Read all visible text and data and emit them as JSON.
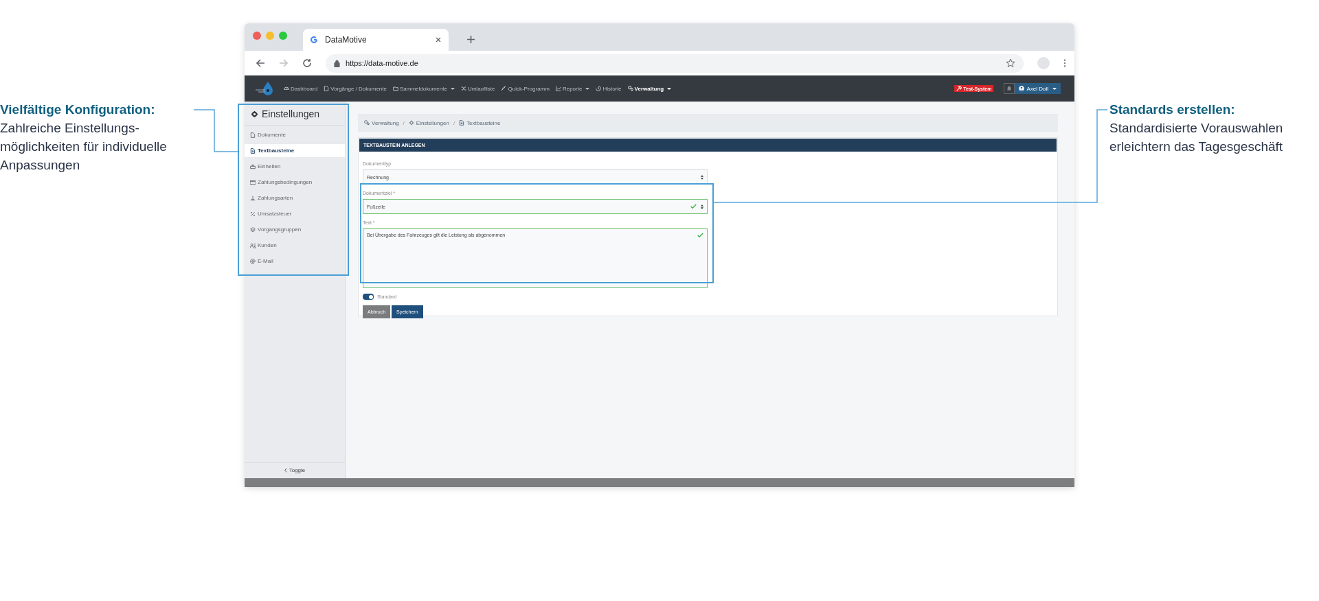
{
  "annotations": [
    {
      "title": "Vielfältige Konfiguration:",
      "lines": [
        "Zahlreiche Einstellungs-",
        "möglichkeiten für individuelle",
        "Anpassungen"
      ]
    },
    {
      "title": "Standards erstellen:",
      "lines": [
        "Standardisierte Vorauswahlen",
        "erleichtern das Tagesgeschäft"
      ]
    }
  ],
  "browser": {
    "tab_title": "DataMotive",
    "url": "https://data-motive.de"
  },
  "navbar": {
    "items": [
      {
        "label": "Dashboard",
        "dropdown": false,
        "active": false
      },
      {
        "label": "Vorgänge / Dokumente",
        "dropdown": false,
        "active": false
      },
      {
        "label": "Sammeldokumente",
        "dropdown": true,
        "active": false
      },
      {
        "label": "Umlaufliste",
        "dropdown": false,
        "active": false
      },
      {
        "label": "Quick-Programm",
        "dropdown": false,
        "active": false
      },
      {
        "label": "Reporte",
        "dropdown": true,
        "active": false
      },
      {
        "label": "Historie",
        "dropdown": false,
        "active": false
      },
      {
        "label": "Verwaltung",
        "dropdown": true,
        "active": true
      }
    ],
    "badge": "Test-System",
    "user": "Axel Doll"
  },
  "sidebar": {
    "title": "Einstellungen",
    "items": [
      {
        "label": "Dokumente",
        "selected": false
      },
      {
        "label": "Textbausteine",
        "selected": true
      },
      {
        "label": "Einheiten",
        "selected": false
      },
      {
        "label": "Zahlungsbedingungen",
        "selected": false
      },
      {
        "label": "Zahlungsarten",
        "selected": false
      },
      {
        "label": "Umsatzsteuer",
        "selected": false
      },
      {
        "label": "Vorgangsgruppen",
        "selected": false
      },
      {
        "label": "Kunden",
        "selected": false
      },
      {
        "label": "E-Mail",
        "selected": false
      }
    ],
    "toggle": "Toggle"
  },
  "breadcrumb": {
    "separator": "/",
    "items": [
      "Verwaltung",
      "Einstellungen",
      "Textbausteine"
    ]
  },
  "form": {
    "header": "TEXTBAUSTEIN ANLEGEN",
    "fields": [
      {
        "kind": "select",
        "label": "Dokumenttyp",
        "value": "Rechnung",
        "valid": false
      },
      {
        "kind": "select",
        "label": "Dokumentziel *",
        "value": "Fußzeile",
        "valid": true
      },
      {
        "kind": "textarea",
        "label": "Text *",
        "value": "Bei Übergabe des Fahrzeuges gilt die Leistung als abgenommen",
        "valid": true
      }
    ],
    "switch": {
      "label": "Standard",
      "on": true
    },
    "buttons": [
      {
        "label": "Abbruch",
        "kind": "secondary"
      },
      {
        "label": "Speichern",
        "kind": "primary"
      }
    ]
  }
}
